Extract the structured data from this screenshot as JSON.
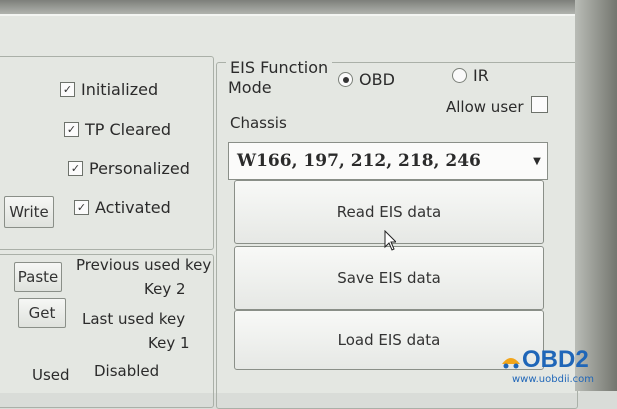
{
  "eis_panel": {
    "title": "EIS Function",
    "mode_label": "Mode",
    "mode_options": [
      "OBD",
      "IR"
    ],
    "mode_selected": "OBD",
    "allow_user_label": "Allow user",
    "chassis_label": "Chassis",
    "chassis_value": "W166, 197, 212, 218, 246",
    "buttons": [
      "Read EIS data",
      "Save EIS data",
      "Load EIS data"
    ]
  },
  "status": {
    "checks": [
      "Initialized",
      "TP Cleared",
      "Personalized",
      "Activated"
    ],
    "write_label": "Write"
  },
  "keys": {
    "paste_label": "Paste",
    "get_label": "Get",
    "previous_label": "Previous used key",
    "previous_value": "Key 2",
    "last_label": "Last used key",
    "last_value": "Key 1",
    "footer_used": "Used",
    "footer_disabled": "Disabled"
  },
  "watermark": {
    "brand": "OBD2",
    "url": "www.uobdii.com"
  },
  "colors": {
    "watermark": "#1f66b8",
    "panel_bg": "#e4e7e2"
  }
}
